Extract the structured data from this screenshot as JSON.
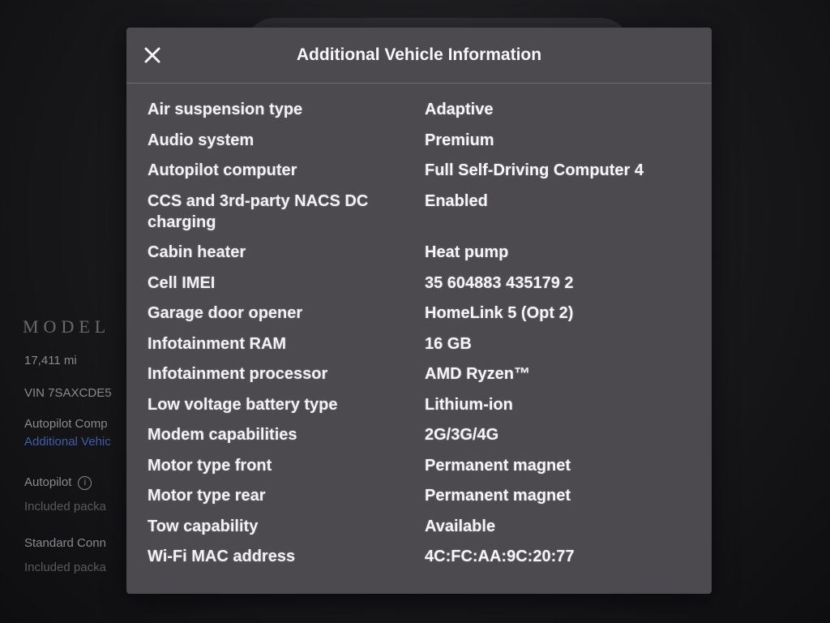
{
  "background": {
    "model_label": "MODEL",
    "mileage": "17,411 mi",
    "vin": "VIN 7SAXCDE5",
    "autopilot_computer_label": "Autopilot Comp",
    "additional_vehicle_link": "Additional Vehic",
    "autopilot_label": "Autopilot",
    "autopilot_sub": "Included packa",
    "standard_conn_label": "Standard Conn",
    "standard_conn_sub": "Included packa"
  },
  "modal": {
    "title": "Additional Vehicle Information",
    "close_icon": "close-icon",
    "rows": [
      {
        "label": "Air suspension type",
        "value": "Adaptive"
      },
      {
        "label": "Audio system",
        "value": "Premium"
      },
      {
        "label": "Autopilot computer",
        "value": "Full Self-Driving Computer 4"
      },
      {
        "label": "CCS and 3rd-party NACS DC charging",
        "value": "Enabled"
      },
      {
        "label": "Cabin heater",
        "value": "Heat pump"
      },
      {
        "label": "Cell IMEI",
        "value": "35 604883 435179 2"
      },
      {
        "label": "Garage door opener",
        "value": "HomeLink 5 (Opt 2)"
      },
      {
        "label": "Infotainment RAM",
        "value": "16 GB"
      },
      {
        "label": "Infotainment processor",
        "value": "AMD Ryzen™"
      },
      {
        "label": "Low voltage battery type",
        "value": "Lithium-ion"
      },
      {
        "label": "Modem capabilities",
        "value": "2G/3G/4G"
      },
      {
        "label": "Motor type front",
        "value": "Permanent magnet"
      },
      {
        "label": "Motor type rear",
        "value": "Permanent magnet"
      },
      {
        "label": "Tow capability",
        "value": "Available"
      },
      {
        "label": "Wi-Fi MAC address",
        "value": "4C:FC:AA:9C:20:77"
      }
    ]
  }
}
